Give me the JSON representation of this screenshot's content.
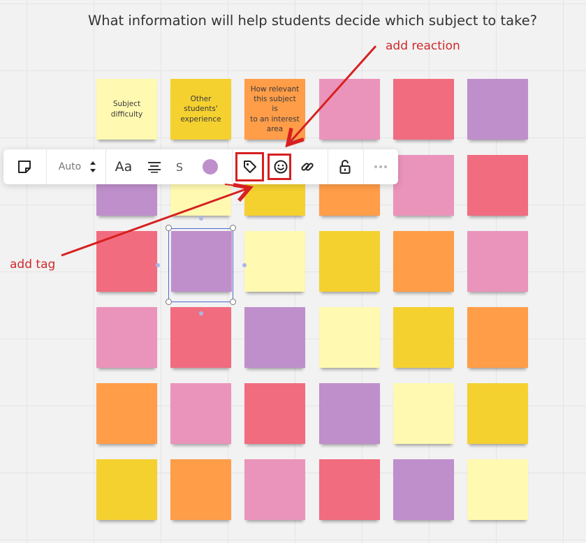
{
  "board": {
    "title": "What information will help students decide which subject to take?",
    "notes": [
      {
        "color": "light-yellow",
        "text": [
          "Subject",
          "difficulty"
        ]
      },
      {
        "color": "yellow",
        "text": [
          "Other",
          "students'",
          "experience"
        ]
      },
      {
        "color": "orange",
        "text": [
          "How relevant",
          "this subject is",
          "to an interest",
          "area"
        ]
      },
      {
        "color": "pink",
        "text": []
      },
      {
        "color": "red",
        "text": []
      },
      {
        "color": "purple",
        "text": []
      },
      {
        "color": "purple",
        "text": []
      },
      {
        "color": "light-yellow",
        "text": []
      },
      {
        "color": "yellow",
        "text": []
      },
      {
        "color": "orange",
        "text": []
      },
      {
        "color": "pink",
        "text": []
      },
      {
        "color": "red",
        "text": []
      },
      {
        "color": "red",
        "text": []
      },
      {
        "color": "purple",
        "text": [],
        "selected": true
      },
      {
        "color": "light-yellow",
        "text": []
      },
      {
        "color": "yellow",
        "text": []
      },
      {
        "color": "orange",
        "text": []
      },
      {
        "color": "pink",
        "text": []
      },
      {
        "color": "pink",
        "text": []
      },
      {
        "color": "red",
        "text": []
      },
      {
        "color": "purple",
        "text": []
      },
      {
        "color": "light-yellow",
        "text": []
      },
      {
        "color": "yellow",
        "text": []
      },
      {
        "color": "orange",
        "text": []
      },
      {
        "color": "orange",
        "text": []
      },
      {
        "color": "pink",
        "text": []
      },
      {
        "color": "red",
        "text": []
      },
      {
        "color": "purple",
        "text": []
      },
      {
        "color": "light-yellow",
        "text": []
      },
      {
        "color": "yellow",
        "text": []
      },
      {
        "color": "yellow",
        "text": []
      },
      {
        "color": "orange",
        "text": []
      },
      {
        "color": "pink",
        "text": []
      },
      {
        "color": "red",
        "text": []
      },
      {
        "color": "purple",
        "text": []
      },
      {
        "color": "light-yellow",
        "text": []
      }
    ]
  },
  "toolbar": {
    "sticky_icon": "sticky-note-icon",
    "font_size": "Auto",
    "font_label": "Aa",
    "align_icon": "align-center-icon",
    "strike_label": "S",
    "fill_color": "#bf8fcc",
    "tag_icon": "tag-icon",
    "reaction_icon": "smiley-icon",
    "link_icon": "link-icon",
    "lock_icon": "unlock-icon",
    "more_icon": "more-icon"
  },
  "annotations": {
    "reaction_label": "add reaction",
    "tag_label": "add tag",
    "color": "#d72020"
  },
  "colors": {
    "light-yellow": "#fff9b1",
    "yellow": "#f5d130",
    "orange": "#ff9d48",
    "pink": "#ea94bb",
    "red": "#f16c7f",
    "purple": "#bf8fcc"
  }
}
